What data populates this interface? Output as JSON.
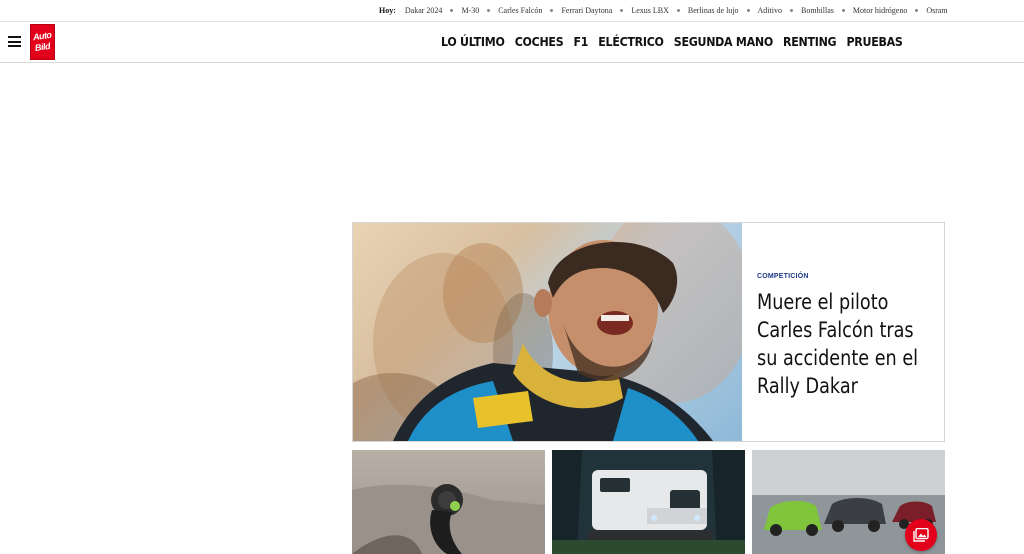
{
  "trending": {
    "label": "Hoy:",
    "items": [
      "Dakar 2024",
      "M-30",
      "Carles Falcón",
      "Ferrari Daytona",
      "Lexus LBX",
      "Berlinas de lujo",
      "Aditivo",
      "Bombillas",
      "Motor hidrógeno",
      "Osram"
    ]
  },
  "header": {
    "logo_line1": "Auto",
    "logo_line2": "Bild",
    "nav": [
      "LO ÚLTIMO",
      "COCHES",
      "F1",
      "ELÉCTRICO",
      "SEGUNDA MANO",
      "RENTING",
      "PRUEBAS"
    ]
  },
  "hero": {
    "category": "COMPETICIÓN",
    "title": "Muere el piloto Carles Falcón tras su accidente en el Rally Dakar"
  },
  "colors": {
    "brand_red": "#e2001a",
    "category_blue": "#1f3a8a"
  },
  "icons": {
    "menu": "hamburger-menu-icon",
    "gallery": "gallery-icon"
  }
}
